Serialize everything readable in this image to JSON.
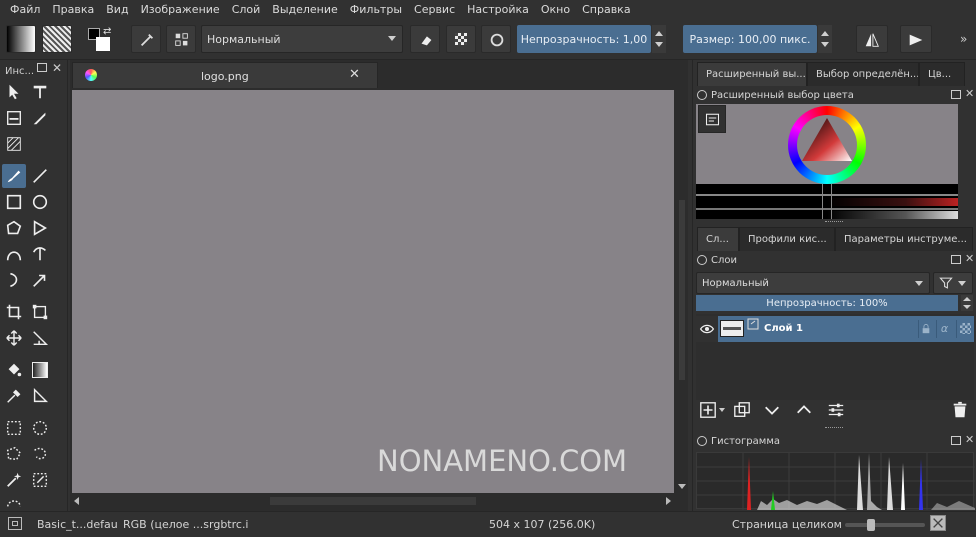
{
  "menubar": {
    "items": [
      "Файл",
      "Правка",
      "Вид",
      "Изображение",
      "Слой",
      "Выделение",
      "Фильтры",
      "Сервис",
      "Настройка",
      "Окно",
      "Справка"
    ]
  },
  "toolbar": {
    "blend_mode": "Нормальный",
    "opacity_label": "Непрозрачность:  1,00",
    "size_label": "Размер:  100,00 пикс."
  },
  "toolbox": {
    "title": "Инс..."
  },
  "document": {
    "tab_title": "logo.png",
    "watermark": "NONAMENO.COM",
    "canvas_color": "#878388"
  },
  "right_dock": {
    "top_tabs": [
      "Расширенный вы...",
      "Выбор определён...",
      "Цв..."
    ],
    "color_panel_title": "Расширенный выбор цвета",
    "mid_tabs": [
      "Сл...",
      "Профили кис...",
      "Параметры инструме..."
    ],
    "layers_title": "Слои",
    "layers_blend_mode": "Нормальный",
    "layers_opacity": "Непрозрачность:  100%",
    "layer_name": "Слой 1",
    "layer_alpha_symbol": "α",
    "histogram_title": "Гистограмма"
  },
  "statusbar": {
    "preset": "Basic_t...defau",
    "colorspace": "RGB (целое ...srgbtrc.i",
    "dimensions": "504 x 107 (256.0K)",
    "zoom_mode": "Страница целиком"
  },
  "colors": {
    "accent": "#4a6e91",
    "background": "#313131"
  }
}
